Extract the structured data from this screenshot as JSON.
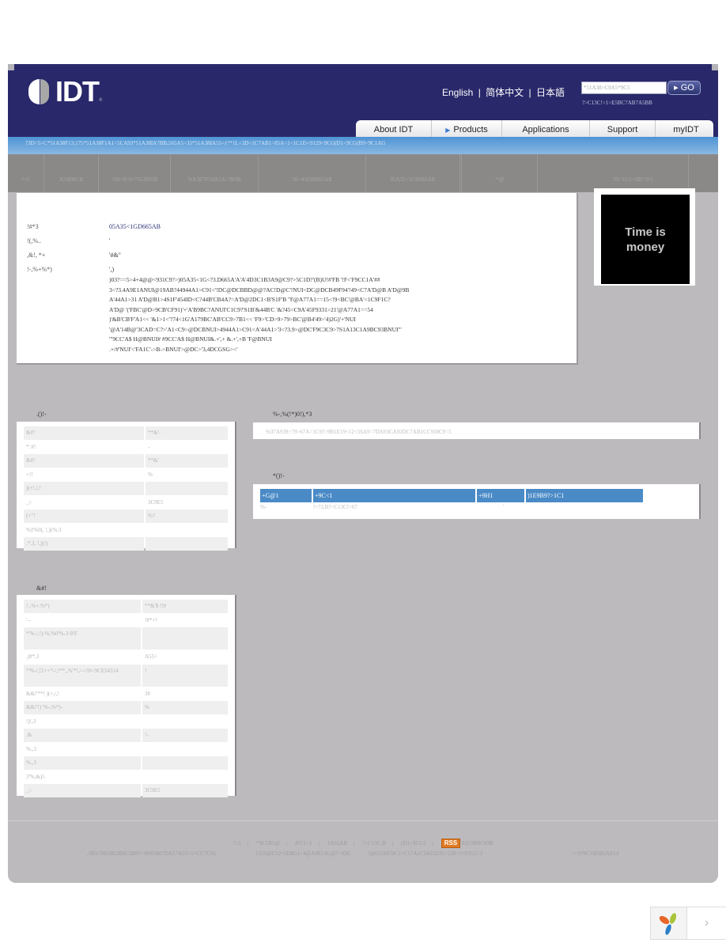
{
  "header": {
    "logo_text": "IDT",
    "logo_reg": "®",
    "languages": [
      "English",
      "|",
      "简体中文",
      "|",
      "日本語"
    ],
    "search": {
      "placeholder": "*51A38>C9A5*9C5",
      "go_label": "GO",
      "advanced_link": "?>C13C!>1>E5BC7AB7A5BB"
    }
  },
  "nav": {
    "tabs": [
      {
        "label": "About IDT",
        "active": false
      },
      {
        "label": "Products",
        "active": true
      },
      {
        "label": "Applications",
        "active": false
      },
      {
        "label": "Support",
        "active": false
      },
      {
        "label": "myIDT",
        "active": false
      }
    ]
  },
  "breadcrumb": "?3D=5>C*51A38F13;175*51A38F1A1=5CA93*51A38IA7BB;565A5>35*51A38IA55>ƒ?*1L<3D<1C7AB1=85A=1<1C1I5<9129<9CG(D1<9CG(B9<9C1AG",
  "subtabs": [
    "?<5",
    "A34D8CB",
    "<93>9<9>7553935B",
    "%X3E7F5AE5A<?B3B",
    "1E>41EID665AB",
    "05A35<1GD665AB",
    "'",
    ".*@",
    "?D=1G1<3B7:9:5"
  ],
  "product": {
    "fields": [
      {
        "label": "!#*3",
        "value": "05A35<1GD665AB",
        "link": true
      },
      {
        "label": "!(,%..",
        "value": "'"
      },
      {
        "label": ",&!, *+",
        "value": "'#&\""
      },
      {
        "label": "!-,%+%*)",
        "value": "',)"
      }
    ],
    "description": ")03?==5>4+4@@<931C9?>)05A35<1G<?3.D665A'A'A'4D3C1B3A9@C9?>5C1D?'(B)U!#'FB '!F<'F9CC1A'##\n3<?3.4A9E1ANUI@19AB?44944A1>C91<'!DC@DCBBD@@?AC!D@C'!NUI<DC@DCB49F94'!49<C7A'D@B A'D@9B\nA'44A1>31 A'D@B1>4S1F'454ID<C?44B'CB4A?=A'D@2DC1<B'S1F'B ''F@A77A1==15<!9<BC'@BA'<1C9F1C?\nA'D@ '('FBC'@D>9CB'CF91)'+'A'B9BC?ANUI'C1C9?'S1B'&44B'C '&?45<C9A'45F9331>21'@A77A1==54\n)'&B'CB'F'A1<< '&1>1<'?74<1G'A179BC'AB'CC9>7B1<< 'F9>'CD>9>79>BC'@B4'49>'4)2G)'+'NUI\n'@A'14B@'3CAD=C?>'A1<C9>@DCBNUI>4944A1>C91<A'44A1>'3<?3.9>@DC'F9C3C9>7S1A13C1A9BC93BNUI'\"\n'\"9CC'A$ H@BNUI# #9CC'A$ H@BNUI&.+',+ &.+',+B 'F@BNUI\n.+/#'NUI'<'FA1C'->B->BNUI'>@DC>'3,4DCGSG><'"
  },
  "promo": {
    "line1": "Time is",
    "line2": "money"
  },
  "specs_left": {
    "title": ".()!-",
    "rows": [
      {
        "k": "&#!",
        "v": "**&'-"
      },
      {
        "k": "*'.#!",
        "v": "-"
      },
      {
        "k": "&#!",
        "v": "**&'"
      },
      {
        "k": "+!!",
        "v": "%"
      },
      {
        "k": ")(+!,/,!",
        "v": ""
      },
      {
        "k": "_/-",
        "v": "3C9E5"
      },
      {
        "k": "(+\"!",
        "v": "%?"
      },
      {
        "k": "%)'%0(, !,)(%.3",
        "v": ""
      },
      {
        "k": ".*.3, !,)(!)",
        "v": ""
      }
    ]
  },
  "specs_left2": {
    "title": "&#!",
    "rows": [
      {
        "k": "!-,%+.%*)",
        "v": "**&'$ !!#"
      },
      {
        "k": "'--",
        "v": "!#*+!"
      },
      {
        "k": "*'%-/,!)-%,%0'%-3 0!F",
        "v": ""
      },
      {
        "k": ",)#*,3",
        "v": "A55>"
      },
      {
        "k": "*'%-/,!2++*-/,!**,,%'*!,/-<59<9CE54314",
        "v": "!"
      },
      {
        "k": "&&!'**! )(+,/,!",
        "v": "3#"
      },
      {
        "k": "&&!'!) '%-,%*)-",
        "v": "%"
      },
      {
        "k": "!)!,3",
        "v": ""
      },
      {
        "k": ",&",
        "v": "!-"
      },
      {
        "k": "%.,3",
        "v": ""
      },
      {
        "k": "%.,3",
        "v": ""
      },
      {
        "k": "3'%,&)!-",
        "v": ""
      },
      {
        "k": "_/-",
        "v": "3C9E5"
      }
    ]
  },
  "distributor": {
    "title": "%-,%(!*)0!),*3",
    "text": "%37A939>79>67A=1C9?>9B1E19<12<56A9=7DA93CA92DC7AB1CC938C9=5"
  },
  "pricing": {
    "title": "*()!-",
    "headers": [
      "+G@1",
      "+9C<1",
      "+9H1",
      ")1E9B9?>1C1"
    ],
    "rows": [
      [
        "%-",
        "!<?3,B?>C13C!>67",
        "'",
        ""
      ]
    ]
  },
  "footer": {
    "links": [
      "?>5",
      "*9C5B1@",
      "#571<1",
      "1A55AB",
      "?>C13C,B",
      "(D1<9CG1"
    ],
    "rss_label": "RSS",
    "rss_text": "81C9B9C89B",
    "line2": [
      ",!B5C9B5B52B9C5B97>9695B07DA17A55>5>CC7C95",
      "1335@C12<5DB51>4@A9E13G@?>93G",
      "?@G1A978C1>C57A1C5455D35>538>?>97G1>3",
      "<<978C1B5B5AE54"
    ]
  },
  "widget": {
    "next_label": "›"
  },
  "colors": {
    "header_bg": "#29286a",
    "page_bg": "#bcbabd",
    "blue_bar": "#4f94d4",
    "table_header": "#4a8ac6",
    "rss": "#e07a22"
  }
}
